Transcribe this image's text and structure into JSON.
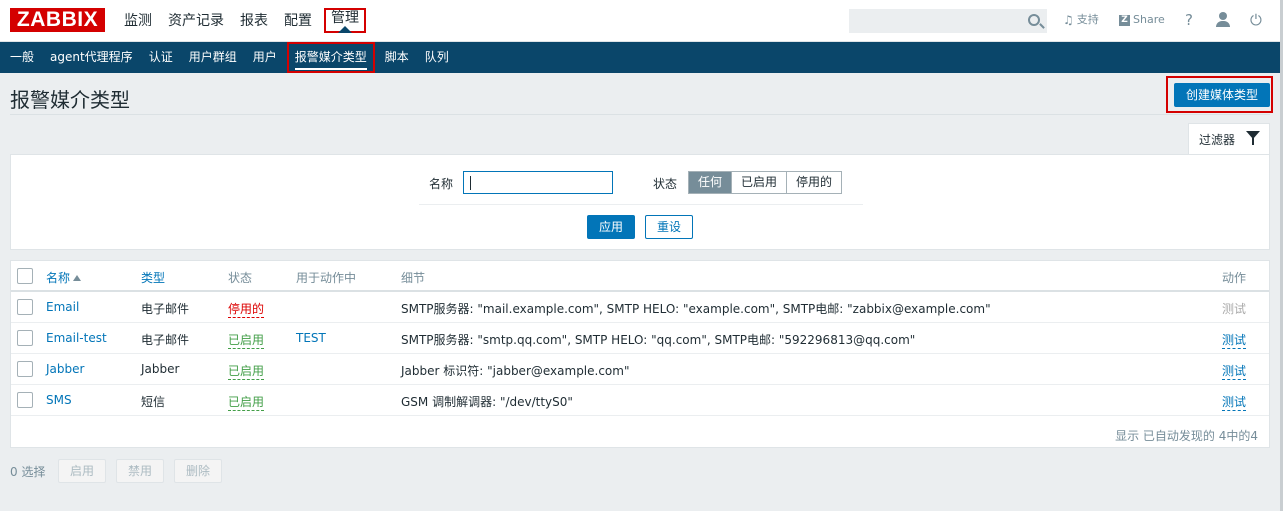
{
  "header": {
    "logo": "ZABBIX",
    "nav": [
      "监测",
      "资产记录",
      "报表",
      "配置",
      "管理"
    ],
    "support": "支持",
    "share": "Share",
    "share_z": "Z",
    "help": "?",
    "power": "⏻"
  },
  "subnav": [
    "一般",
    "agent代理程序",
    "认证",
    "用户群组",
    "用户",
    "报警媒介类型",
    "脚本",
    "队列"
  ],
  "page": {
    "title": "报警媒介类型",
    "create_button": "创建媒体类型"
  },
  "filter": {
    "tab_label": "过滤器",
    "name_label": "名称",
    "name_value": "",
    "status_label": "状态",
    "status_options": [
      "任何",
      "已启用",
      "停用的"
    ],
    "status_selected": "任何",
    "apply": "应用",
    "reset": "重设"
  },
  "table": {
    "headers": [
      "名称",
      "类型",
      "状态",
      "用于动作中",
      "细节",
      "动作"
    ],
    "rows": [
      {
        "name": "Email",
        "type": "电子邮件",
        "status": "停用的",
        "used": "",
        "details": "SMTP服务器: \"mail.example.com\", SMTP HELO: \"example.com\", SMTP电邮: \"zabbix@example.com\"",
        "action": "测试"
      },
      {
        "name": "Email-test",
        "type": "电子邮件",
        "status": "已启用",
        "used": "TEST",
        "details": "SMTP服务器: \"smtp.qq.com\", SMTP HELO: \"qq.com\", SMTP电邮: \"592296813@qq.com\"",
        "action": "测试"
      },
      {
        "name": "Jabber",
        "type": "Jabber",
        "status": "已启用",
        "used": "",
        "details": "Jabber 标识符: \"jabber@example.com\"",
        "action": "测试"
      },
      {
        "name": "SMS",
        "type": "短信",
        "status": "已启用",
        "used": "",
        "details": "GSM 调制解调器: \"/dev/ttyS0\"",
        "action": "测试"
      }
    ],
    "footer": "显示 已自动发现的 4中的4"
  },
  "bottom": {
    "selected": "0 选择",
    "buttons": [
      "启用",
      "禁用",
      "删除"
    ]
  }
}
